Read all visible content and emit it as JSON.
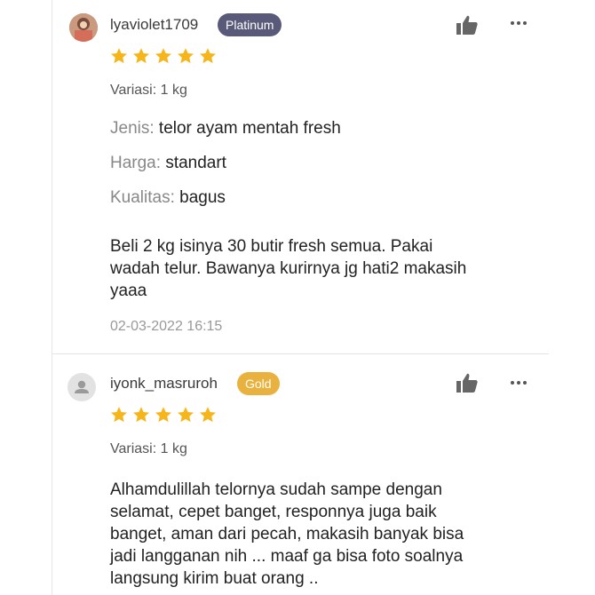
{
  "reviews": [
    {
      "username": "lyaviolet1709",
      "badge": "Platinum",
      "stars": 5,
      "variasi": "Variasi: 1 kg",
      "attributes": [
        {
          "key": "Jenis:",
          "value": "telor ayam mentah fresh"
        },
        {
          "key": "Harga:",
          "value": "standart"
        },
        {
          "key": "Kualitas:",
          "value": "bagus"
        }
      ],
      "body_lines": [
        "Beli 2 kg isinya 30 butir fresh semua. Pakai",
        "wadah telur. Bawanya kurirnya jg hati2 makasih",
        "yaaa"
      ],
      "date": "02-03-2022 16:15"
    },
    {
      "username": "iyonk_masruroh",
      "badge": "Gold",
      "stars": 5,
      "variasi": "Variasi: 1 kg",
      "body_lines": [
        "Alhamdulillah telornya sudah sampe dengan",
        "selamat, cepet banget, responnya juga baik",
        "banget, aman dari pecah, makasih banyak bisa",
        "jadi langganan nih ... maaf ga bisa foto soalnya",
        "langsung kirim buat orang .."
      ]
    }
  ],
  "colors": {
    "star": "#f6b51b",
    "platinum_badge": "#59597a",
    "gold_badge": "#e9b13d"
  }
}
